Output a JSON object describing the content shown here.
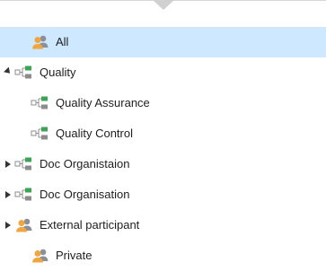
{
  "tree": {
    "items": [
      {
        "label": "All",
        "icon": "group-users-icon",
        "selected": true,
        "expander": "none"
      },
      {
        "label": "Quality",
        "icon": "hierarchy-icon",
        "selected": false,
        "expander": "expanded"
      },
      {
        "label": "Quality Assurance",
        "icon": "hierarchy-icon",
        "selected": false,
        "expander": "none"
      },
      {
        "label": "Quality Control",
        "icon": "hierarchy-icon",
        "selected": false,
        "expander": "none"
      },
      {
        "label": "Doc Organistaion",
        "icon": "hierarchy-icon",
        "selected": false,
        "expander": "collapsed"
      },
      {
        "label": "Doc Organisation",
        "icon": "hierarchy-icon",
        "selected": false,
        "expander": "collapsed"
      },
      {
        "label": "External participant",
        "icon": "group-users-icon",
        "selected": false,
        "expander": "collapsed"
      },
      {
        "label": "Private",
        "icon": "group-users-icon",
        "selected": false,
        "expander": "none"
      }
    ]
  },
  "colors": {
    "selection": "#cde8ff",
    "users_orange": "#f0a640",
    "users_gray": "#8a8f99",
    "hierarchy_green": "#3aa655",
    "hierarchy_gray": "#8c8c8c"
  }
}
